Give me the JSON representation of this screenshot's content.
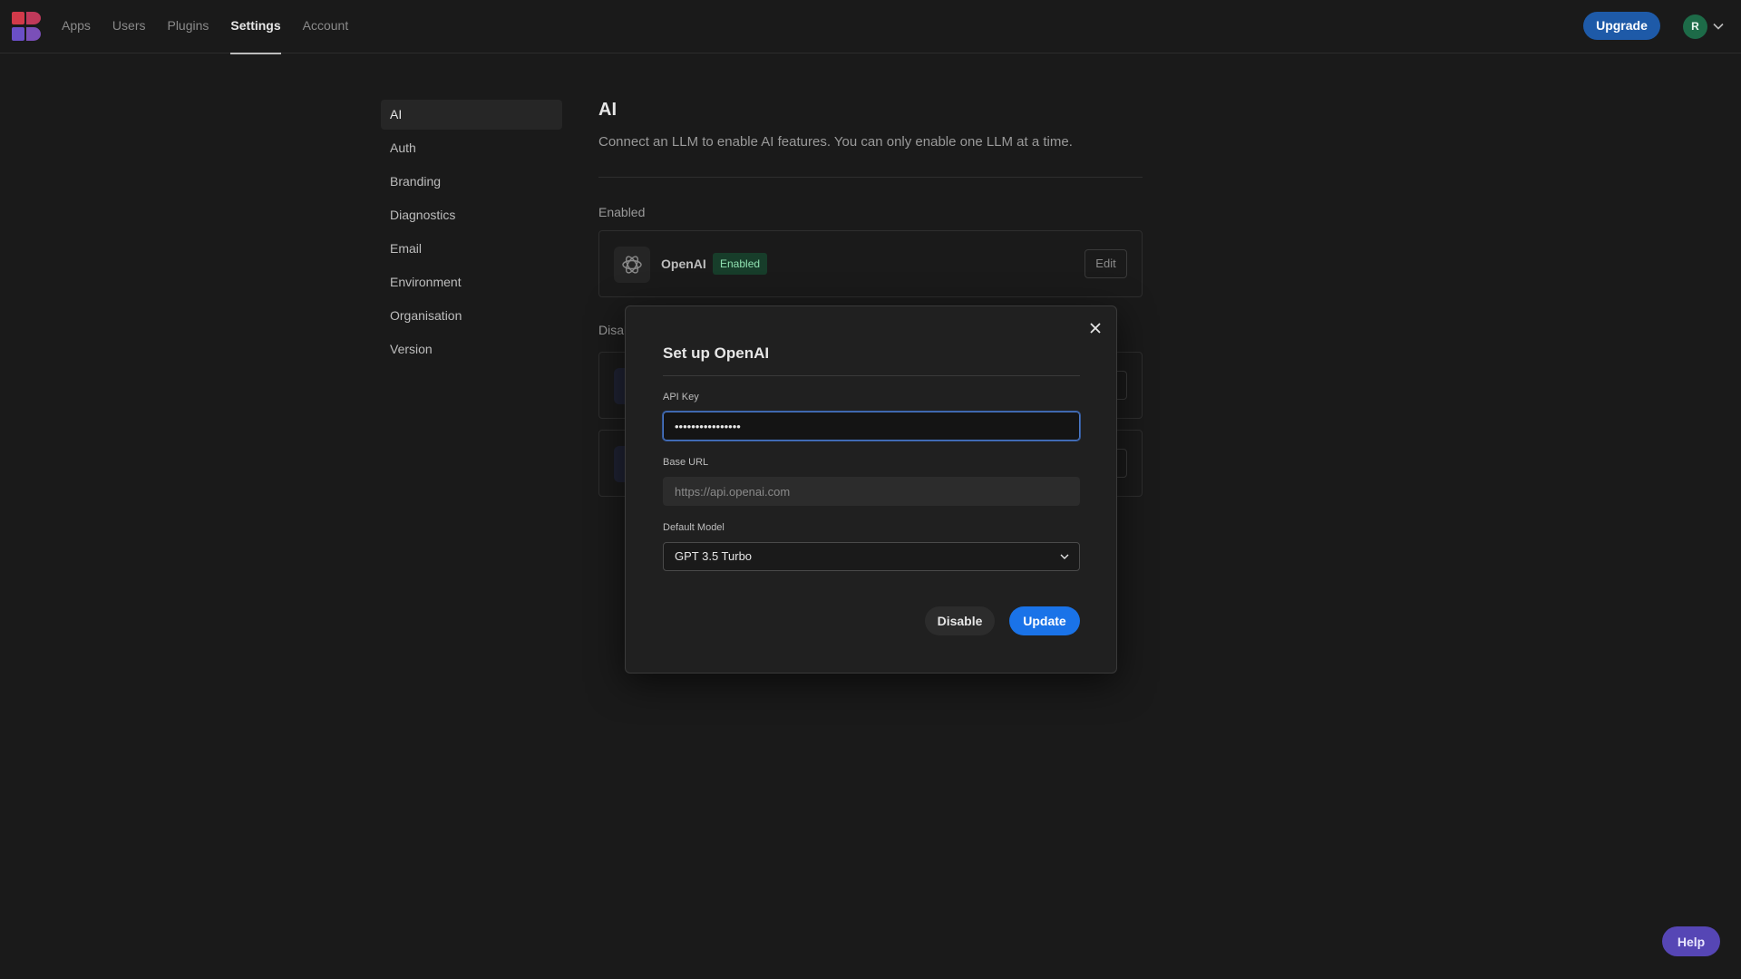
{
  "nav": {
    "items": [
      {
        "label": "Apps"
      },
      {
        "label": "Users"
      },
      {
        "label": "Plugins"
      },
      {
        "label": "Settings"
      },
      {
        "label": "Account"
      }
    ],
    "active": "Settings",
    "upgrade_label": "Upgrade",
    "avatar_initial": "R"
  },
  "sidebar": {
    "items": [
      {
        "label": "AI"
      },
      {
        "label": "Auth"
      },
      {
        "label": "Branding"
      },
      {
        "label": "Diagnostics"
      },
      {
        "label": "Email"
      },
      {
        "label": "Environment"
      },
      {
        "label": "Organisation"
      },
      {
        "label": "Version"
      }
    ],
    "active": "AI"
  },
  "main": {
    "title": "AI",
    "description": "Connect an LLM to enable AI features. You can only enable one LLM at a time.",
    "enabled_section_label": "Enabled",
    "disabled_section_label": "Disal",
    "enabled_llm": {
      "name": "OpenAI",
      "badge": "Enabled",
      "edit_label": "Edit"
    }
  },
  "modal": {
    "title": "Set up OpenAI",
    "api_key": {
      "label": "API Key",
      "value": "••••••••••••••••"
    },
    "base_url": {
      "label": "Base URL",
      "placeholder": "https://api.openai.com",
      "value": ""
    },
    "default_model": {
      "label": "Default Model",
      "value": "GPT 3.5 Turbo"
    },
    "disable_label": "Disable",
    "update_label": "Update"
  },
  "help_label": "Help",
  "colors": {
    "background": "#1a1a1a",
    "primary": "#1a73e8",
    "upgrade": "#1e5aa8",
    "help": "#5646b5",
    "badge_green": "#173d2a"
  },
  "icons": [
    "app-logo-icon",
    "chevron-down-icon",
    "openai-logo-icon",
    "close-icon"
  ]
}
